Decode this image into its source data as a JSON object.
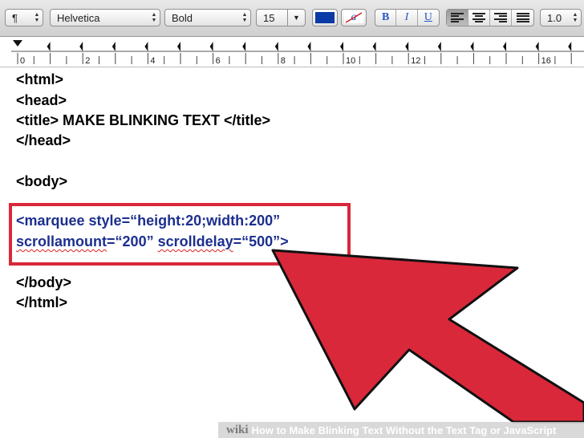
{
  "toolbar": {
    "style_menu_label": "¶",
    "font_family": "Helvetica",
    "font_style": "Bold",
    "font_size": "15",
    "text_color": "#0a3aa6",
    "highlight_glyph": "a",
    "bold_label": "B",
    "italic_label": "I",
    "underline_label": "U",
    "line_spacing": "1.0"
  },
  "ruler": {
    "labels": [
      "0",
      "2",
      "4",
      "6",
      "8",
      "10",
      "12",
      "16"
    ]
  },
  "document": {
    "lines": [
      "<html>",
      "<head>",
      "<title> MAKE BLINKING TEXT </title>",
      "</head>",
      "",
      "<body>",
      "",
      "<marquee style=“height:20;width:200”",
      "scrollamount=“200” scrolldelay=“500”>",
      "",
      "</body>",
      "</html>"
    ],
    "line2_part1": "scrollamount",
    "line2_part2": "=“200” ",
    "line2_part3": "scrolldelay",
    "line2_part4": "=“500”>"
  },
  "colors": {
    "highlight_border": "#d9283a",
    "arrow_fill": "#d9283a",
    "code_blue": "#1c2f8f"
  },
  "footer": {
    "wiki": "wiki",
    "how": "How",
    "text": "How to Make Blinking Text Without the Text Tag or JavaScript"
  }
}
